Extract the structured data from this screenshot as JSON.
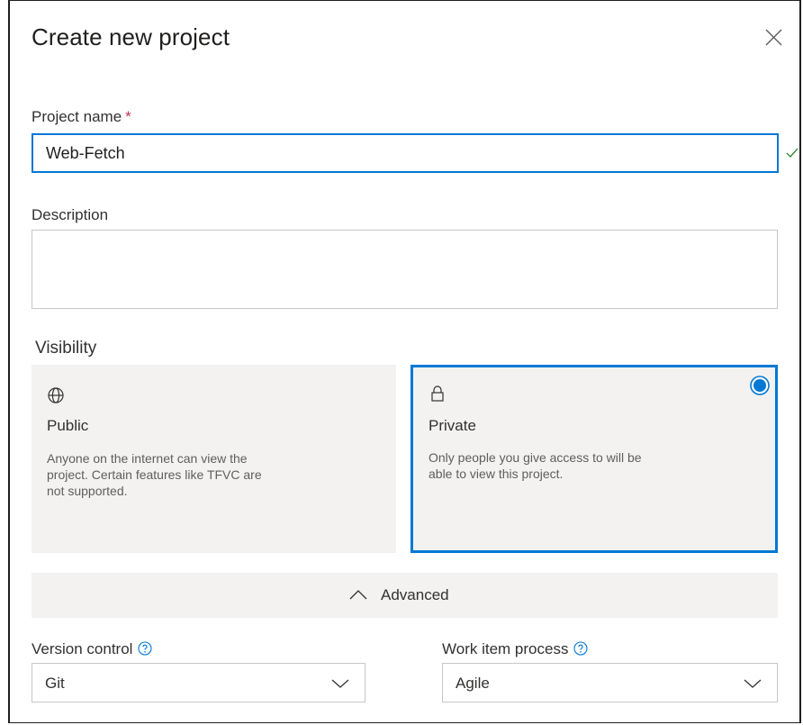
{
  "dialog": {
    "title": "Create new project"
  },
  "project_name": {
    "label": "Project name",
    "required_marker": "*",
    "value": "Web-Fetch"
  },
  "description": {
    "label": "Description",
    "value": ""
  },
  "visibility": {
    "label": "Visibility",
    "options": [
      {
        "title": "Public",
        "icon": "globe-icon",
        "description": "Anyone on the internet can view the project. Certain features like TFVC are not supported.",
        "selected": false
      },
      {
        "title": "Private",
        "icon": "lock-icon",
        "description": "Only people you give access to will be able to view this project.",
        "selected": true
      }
    ]
  },
  "advanced": {
    "label": "Advanced",
    "expanded": true
  },
  "version_control": {
    "label": "Version control",
    "value": "Git"
  },
  "work_item_process": {
    "label": "Work item process",
    "value": "Agile"
  },
  "colors": {
    "accent": "#0078d4",
    "required": "#c4314b",
    "valid": "#107c10",
    "card_bg": "#f3f2f1"
  }
}
